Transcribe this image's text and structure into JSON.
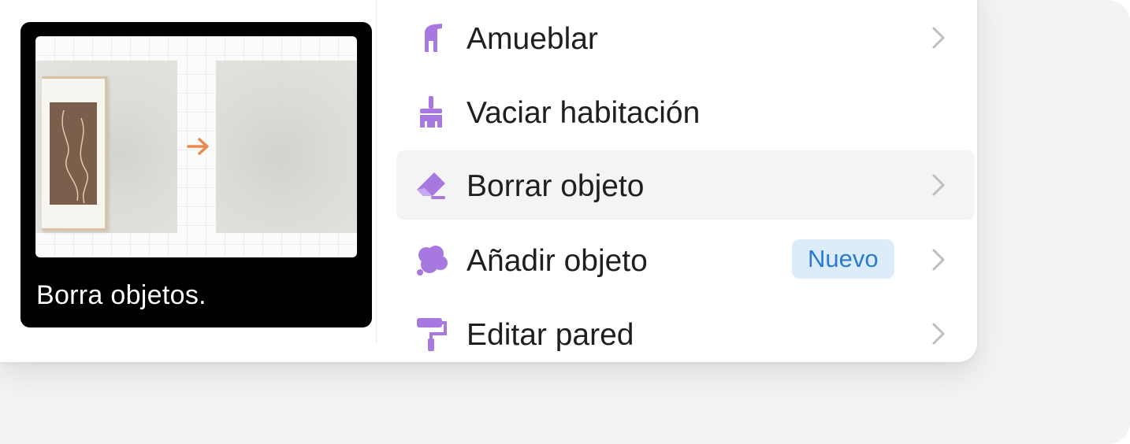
{
  "tooltip": {
    "caption": "Borra objetos."
  },
  "menu": {
    "items": [
      {
        "label": "Amueblar",
        "icon": "chair-icon",
        "has_submenu": true
      },
      {
        "label": "Vaciar habitación",
        "icon": "broom-icon",
        "has_submenu": false
      },
      {
        "label": "Borrar objeto",
        "icon": "eraser-icon",
        "has_submenu": true,
        "active": true
      },
      {
        "label": "Añadir objeto",
        "icon": "cloud-icon",
        "has_submenu": true,
        "badge": "Nuevo"
      },
      {
        "label": "Editar pared",
        "icon": "paint-roller-icon",
        "has_submenu": true
      }
    ]
  },
  "colors": {
    "icon_accent": "#a678e0",
    "badge_bg": "#dcecfb",
    "badge_text": "#2b7bd2",
    "arrow": "#ec8a4e",
    "active_row": "#f4f4f5"
  }
}
